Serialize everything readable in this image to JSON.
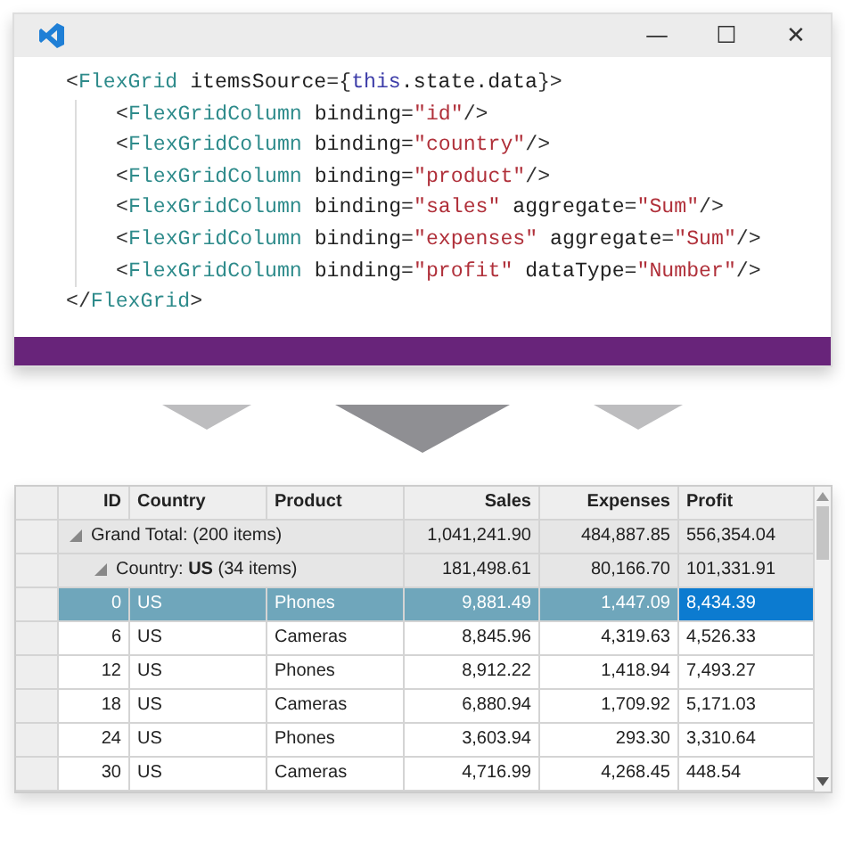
{
  "editor": {
    "window_controls": [
      "—",
      "☐",
      "✕"
    ],
    "code": {
      "open": [
        {
          "kind": "punct",
          "text": "<"
        },
        {
          "kind": "tag",
          "text": "FlexGrid"
        },
        {
          "kind": "attr",
          "text": " itemsSource="
        },
        {
          "kind": "punct",
          "text": "{"
        },
        {
          "kind": "keyword",
          "text": "this"
        },
        {
          "kind": "attr",
          "text": ".state.data"
        },
        {
          "kind": "punct",
          "text": "}>"
        }
      ],
      "children": [
        [
          {
            "kind": "punct",
            "text": "<"
          },
          {
            "kind": "tag",
            "text": "FlexGridColumn"
          },
          {
            "kind": "attr",
            "text": " binding="
          },
          {
            "kind": "string",
            "text": "\"id\""
          },
          {
            "kind": "punct",
            "text": "/>"
          }
        ],
        [
          {
            "kind": "punct",
            "text": "<"
          },
          {
            "kind": "tag",
            "text": "FlexGridColumn"
          },
          {
            "kind": "attr",
            "text": " binding="
          },
          {
            "kind": "string",
            "text": "\"country\""
          },
          {
            "kind": "punct",
            "text": "/>"
          }
        ],
        [
          {
            "kind": "punct",
            "text": "<"
          },
          {
            "kind": "tag",
            "text": "FlexGridColumn"
          },
          {
            "kind": "attr",
            "text": " binding="
          },
          {
            "kind": "string",
            "text": "\"product\""
          },
          {
            "kind": "punct",
            "text": "/>"
          }
        ],
        [
          {
            "kind": "punct",
            "text": "<"
          },
          {
            "kind": "tag",
            "text": "FlexGridColumn"
          },
          {
            "kind": "attr",
            "text": " binding="
          },
          {
            "kind": "string",
            "text": "\"sales\""
          },
          {
            "kind": "attr",
            "text": " aggregate="
          },
          {
            "kind": "string",
            "text": "\"Sum\""
          },
          {
            "kind": "punct",
            "text": "/>"
          }
        ],
        [
          {
            "kind": "punct",
            "text": "<"
          },
          {
            "kind": "tag",
            "text": "FlexGridColumn"
          },
          {
            "kind": "attr",
            "text": " binding="
          },
          {
            "kind": "string",
            "text": "\"expenses\""
          },
          {
            "kind": "attr",
            "text": " aggregate="
          },
          {
            "kind": "string",
            "text": "\"Sum\""
          },
          {
            "kind": "punct",
            "text": "/>"
          }
        ],
        [
          {
            "kind": "punct",
            "text": "<"
          },
          {
            "kind": "tag",
            "text": "FlexGridColumn"
          },
          {
            "kind": "attr",
            "text": " binding="
          },
          {
            "kind": "string",
            "text": "\"profit\""
          },
          {
            "kind": "attr",
            "text": " dataType="
          },
          {
            "kind": "string",
            "text": "\"Number\""
          },
          {
            "kind": "punct",
            "text": "/>"
          }
        ]
      ],
      "close": [
        {
          "kind": "punct",
          "text": "</"
        },
        {
          "kind": "tag",
          "text": "FlexGrid"
        },
        {
          "kind": "punct",
          "text": ">"
        }
      ]
    }
  },
  "grid": {
    "columns": [
      "ID",
      "Country",
      "Product",
      "Sales",
      "Expenses",
      "Profit"
    ],
    "rows": [
      {
        "kind": "group",
        "label": "Grand Total: (200 items)",
        "sales": "1,041,241.90",
        "expenses": "484,887.85",
        "profit": "556,354.04",
        "expanded": true,
        "children": [
          {
            "kind": "group",
            "label": "Country: **US** (34 items)",
            "sales": "181,498.61",
            "expenses": "80,166.70",
            "profit": "101,331.91",
            "expanded": true,
            "children": [
              {
                "kind": "data",
                "id": "0",
                "country": "US",
                "product": "Phones",
                "sales": "9,881.49",
                "expenses": "1,447.09",
                "profit": "8,434.39",
                "selected": true,
                "profit_current": true
              },
              {
                "kind": "data",
                "id": "6",
                "country": "US",
                "product": "Cameras",
                "sales": "8,845.96",
                "expenses": "4,319.63",
                "profit": "4,526.33",
                "selected": false,
                "profit_current": false
              },
              {
                "kind": "data",
                "id": "12",
                "country": "US",
                "product": "Phones",
                "sales": "8,912.22",
                "expenses": "1,418.94",
                "profit": "7,493.27",
                "selected": false,
                "profit_current": false
              },
              {
                "kind": "data",
                "id": "18",
                "country": "US",
                "product": "Cameras",
                "sales": "6,880.94",
                "expenses": "1,709.92",
                "profit": "5,171.03",
                "selected": false,
                "profit_current": false
              },
              {
                "kind": "data",
                "id": "24",
                "country": "US",
                "product": "Phones",
                "sales": "3,603.94",
                "expenses": "293.30",
                "profit": "3,310.64",
                "selected": false,
                "profit_current": false
              },
              {
                "kind": "data",
                "id": "30",
                "country": "US",
                "product": "Cameras",
                "sales": "4,716.99",
                "expenses": "4,268.45",
                "profit": "448.54",
                "selected": false,
                "profit_current": false
              }
            ]
          }
        ]
      }
    ]
  }
}
